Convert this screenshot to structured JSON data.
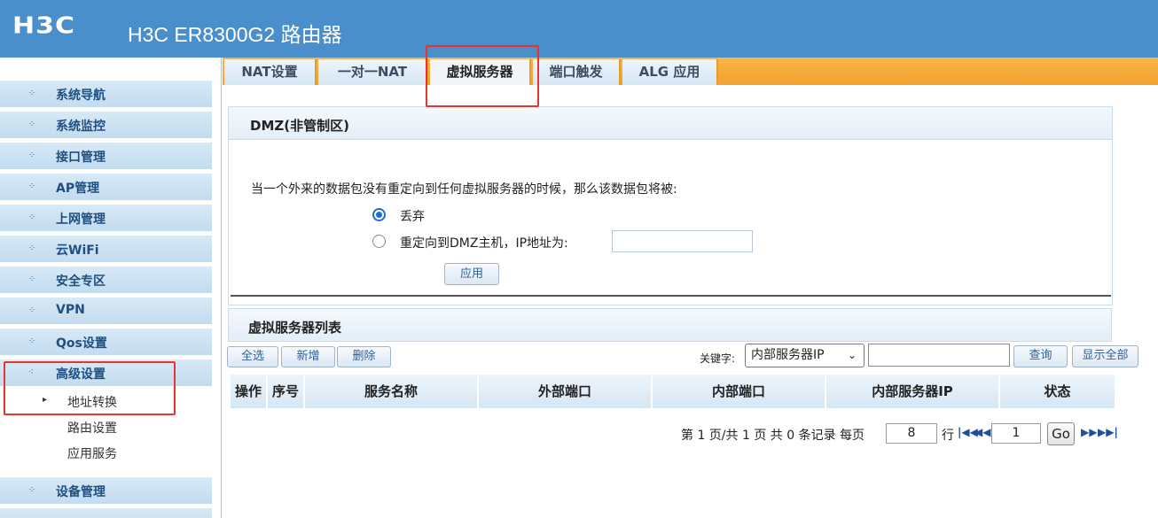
{
  "header": {
    "logo": "H3C",
    "title": "H3C ER8300G2 路由器"
  },
  "sidebar": {
    "items": [
      {
        "label": "系统导航"
      },
      {
        "label": "系统监控"
      },
      {
        "label": "接口管理"
      },
      {
        "label": "AP管理"
      },
      {
        "label": "上网管理"
      },
      {
        "label": "云WiFi"
      },
      {
        "label": "安全专区"
      },
      {
        "label": "VPN"
      },
      {
        "label": "Qos设置"
      },
      {
        "label": "高级设置"
      },
      {
        "label": "设备管理"
      }
    ],
    "subitems": [
      {
        "label": "地址转换"
      },
      {
        "label": "路由设置"
      },
      {
        "label": "应用服务"
      }
    ]
  },
  "tabs": [
    {
      "label": "NAT设置"
    },
    {
      "label": "一对一NAT"
    },
    {
      "label": "虚拟服务器"
    },
    {
      "label": "端口触发"
    },
    {
      "label": "ALG 应用"
    }
  ],
  "dmz": {
    "title": "DMZ(非管制区)",
    "description": "当一个外来的数据包没有重定向到任何虚拟服务器的时候，那么该数据包将被:",
    "option_discard": "丢弃",
    "option_redirect": "重定向到DMZ主机，IP地址为:",
    "ip_value": "",
    "apply_button": "应用"
  },
  "list": {
    "title": "虚拟服务器列表",
    "select_all": "全选",
    "add": "新增",
    "delete": "删除",
    "keyword_label": "关键字:",
    "keyword_select": "内部服务器IP",
    "keyword_value": "",
    "search": "查询",
    "show_all": "显示全部",
    "columns": [
      "操作",
      "序号",
      "服务名称",
      "外部端口",
      "内部端口",
      "内部服务器IP",
      "状态"
    ]
  },
  "pager": {
    "summary": "第 1 页/共 1 页 共 0 条记录 每页",
    "per_page": "8",
    "rows_label": "行",
    "page": "1",
    "go": "Go"
  },
  "colors": {
    "header": "#4a8fcb",
    "tabs_bar": "#f3a22d",
    "highlight": "#e8332e",
    "radio": "#1c6ed6"
  }
}
